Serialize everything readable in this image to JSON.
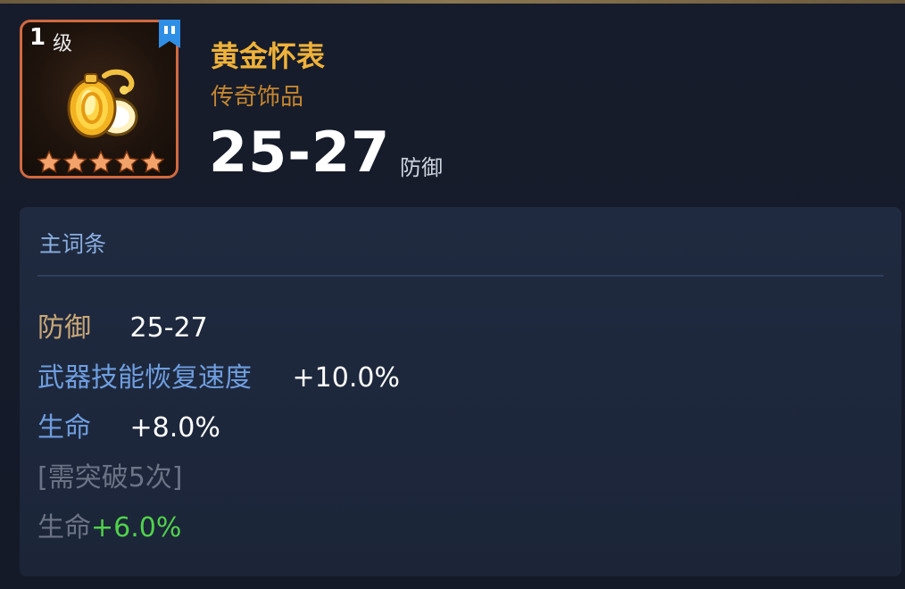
{
  "item": {
    "level_number": "1",
    "level_unit": "级",
    "stars": 5,
    "name": "黄金怀表",
    "type": "传奇饰品",
    "main_value": "25-27",
    "main_unit": "防御"
  },
  "attributes_panel": {
    "title": "主词条",
    "rows": [
      {
        "label": "防御",
        "value": "25-27"
      },
      {
        "label": "武器技能恢复速度",
        "value": "+10.0%"
      },
      {
        "label": "生命",
        "value": "+8.0%"
      },
      {
        "label": "[需突破5次]",
        "value": ""
      },
      {
        "label": "生命",
        "value": "+6.0%"
      }
    ]
  },
  "colors": {
    "frame": "#d2693f",
    "name": "#f0b23a",
    "type": "#c5852f",
    "green": "#4fd24a",
    "blue_label": "#6e9ee0",
    "gold_label": "#c9a877"
  },
  "icons": {
    "item": "golden-pocket-watch-icon",
    "bookmark": "bookmark-icon",
    "star": "star-icon"
  }
}
